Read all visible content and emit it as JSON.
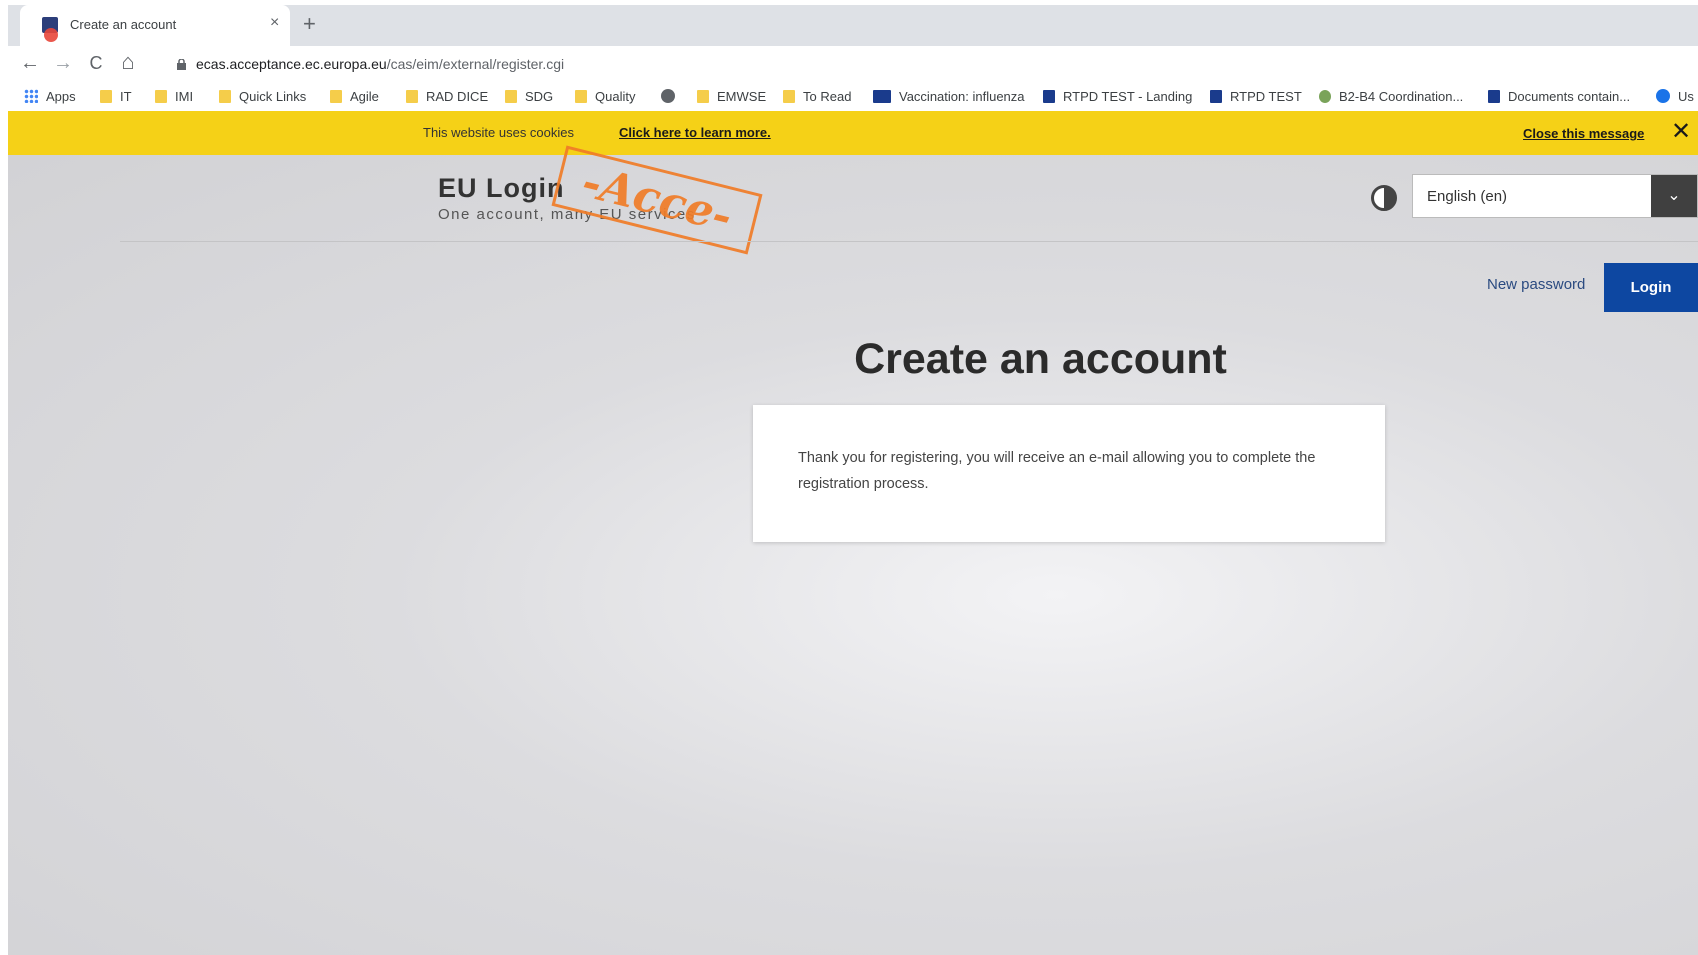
{
  "browser": {
    "tab": {
      "title": "Create an account",
      "close_glyph": "×",
      "favicon": "eu-login-favicon"
    },
    "new_tab_glyph": "+",
    "nav": {
      "back": "←",
      "forward": "→",
      "reload": "C",
      "home": "⌂"
    },
    "url": {
      "host": "ecas.acceptance.ec.europa.eu",
      "path": "/cas/eim/external/register.cgi"
    },
    "bookmarks": [
      {
        "label": "Apps",
        "icon": "apps-grid-icon"
      },
      {
        "label": "IT",
        "icon": "folder-icon"
      },
      {
        "label": "IMI",
        "icon": "folder-icon"
      },
      {
        "label": "Quick Links",
        "icon": "folder-icon"
      },
      {
        "label": "Agile",
        "icon": "folder-icon"
      },
      {
        "label": "RAD DICE",
        "icon": "folder-icon"
      },
      {
        "label": "SDG",
        "icon": "folder-icon"
      },
      {
        "label": "Quality",
        "icon": "folder-icon"
      },
      {
        "label": "",
        "icon": "globe-icon"
      },
      {
        "label": "EMWSE",
        "icon": "folder-icon"
      },
      {
        "label": "To Read",
        "icon": "folder-icon"
      },
      {
        "label": "Vaccination: influenza",
        "icon": "eu-flag-icon"
      },
      {
        "label": "RTPD TEST - Landing",
        "icon": "eu-flag-icon"
      },
      {
        "label": "RTPD TEST",
        "icon": "eu-flag-icon"
      },
      {
        "label": "B2-B4 Coordination...",
        "icon": "leaf-icon"
      },
      {
        "label": "Documents contain...",
        "icon": "eu-flag-icon"
      },
      {
        "label": "Us",
        "icon": "globe-icon"
      }
    ]
  },
  "cookie_banner": {
    "text": "This website uses cookies",
    "learn_more": "Click here to learn more.",
    "close_label": "Close this message",
    "close_glyph": "✕",
    "color": "#f5d117"
  },
  "header": {
    "logo_title": "EU Login",
    "logo_subtitle": "One account, many EU services",
    "stamp": "-Acce-",
    "language": "English (en)",
    "language_arrow": "⌄"
  },
  "actions": {
    "new_password": "New password",
    "login": "Login",
    "login_color": "#0d47a1"
  },
  "main": {
    "title": "Create an account",
    "message": "Thank you for registering, you will receive an e-mail allowing you to complete the registration process."
  }
}
